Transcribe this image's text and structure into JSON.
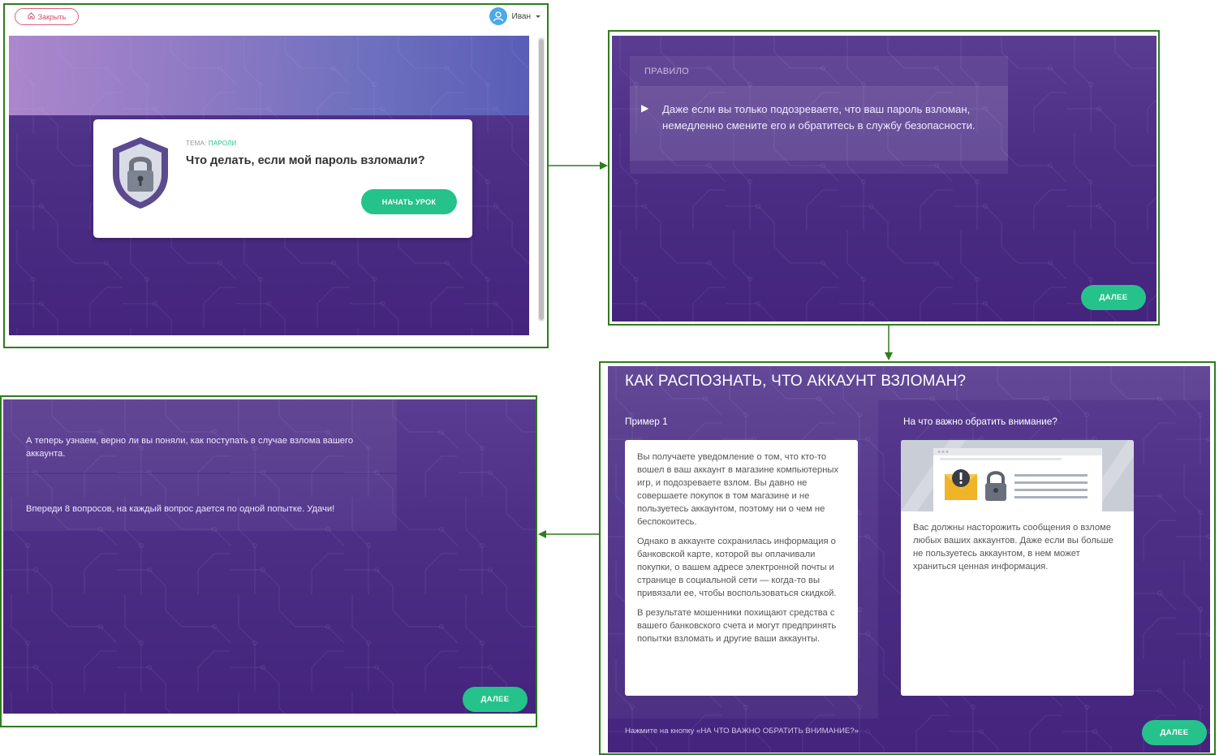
{
  "colors": {
    "frame_border": "#2e7d1e",
    "accent_green": "#26c28b",
    "purple": "#4d2f86",
    "close_red": "#d24a64"
  },
  "panel1": {
    "close_label": "Закрыть",
    "user_name": "Иван",
    "user_menu_icon": "chevron-down-icon",
    "topic_label": "ТЕМА:",
    "topic_value": "ПАРОЛИ",
    "lesson_title": "Что делать, если мой пароль взломали?",
    "start_button": "НАЧАТЬ УРОК",
    "icon": "shield-lock-icon"
  },
  "panel2": {
    "rule_label": "ПРАВИЛО",
    "rule_text": "Даже если вы только подозреваете, что ваш пароль взломан, немедленно смените его и обратитесь в службу безопасности.",
    "next_button": "ДАЛЕЕ"
  },
  "panel3": {
    "title": "КАК РАСПОЗНАТЬ, ЧТО АККАУНТ ВЗЛОМАН?",
    "left_heading": "Пример 1",
    "right_heading": "На что важно обратить внимание?",
    "left_paragraphs": [
      "Вы получаете уведомление о том, что кто-то вошел в ваш аккаунт в магазине компьютерных игр, и подозреваете взлом. Вы давно не совершаете покупок в том магазине и не пользуетесь аккаунтом, поэтому ни о чем не беспокоитесь.",
      "Однако в аккаунте сохранилась информация о банковской карте, которой вы оплачивали покупки, о вашем адресе электронной почты и странице в социальной сети — когда-то вы привязали ее, чтобы воспользоваться скидкой.",
      "В результате мошенники похищают средства с вашего банковского счета и могут предпринять попытки взломать и другие ваши аккаунты."
    ],
    "right_text": "Вас должны насторожить сообщения о взломе любых ваших аккаунтов. Даже если вы больше не пользуетесь аккаунтом, в нем может храниться ценная информация.",
    "hint": "Нажмите на кнопку «НА ЧТО ВАЖНО ОБРАТИТЬ ВНИМАНИЕ?»",
    "next_button": "ДАЛЕЕ"
  },
  "panel4": {
    "text1": "А теперь узнаем, верно ли вы поняли, как поступать в случае взлома вашего аккаунта.",
    "text2": "Впереди 8 вопросов, на каждый вопрос дается по одной попытке. Удачи!",
    "next_button": "ДАЛЕЕ"
  }
}
